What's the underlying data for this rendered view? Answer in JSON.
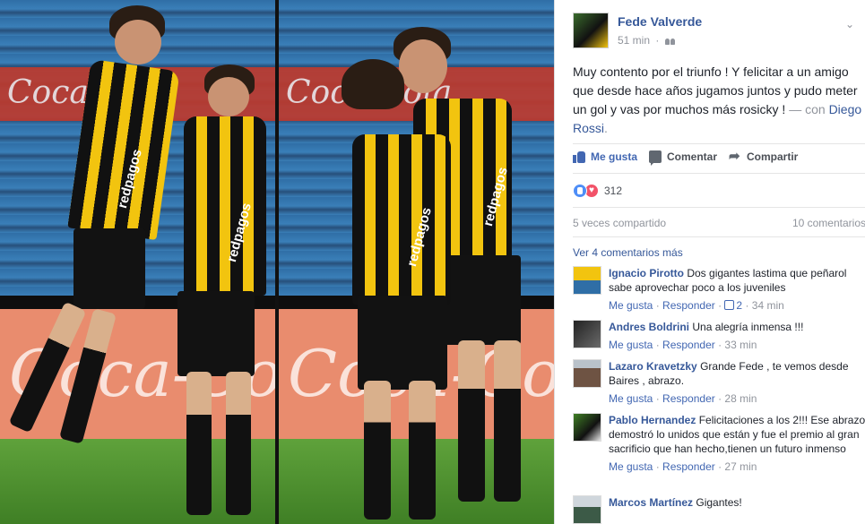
{
  "photo": {
    "ad_text": "Coca-Cola",
    "sponsor": "redpagos"
  },
  "post": {
    "author": "Fede Valverde",
    "time": "51 min",
    "separator": "·",
    "audience_icon": "friends-icon",
    "text_main": "Muy contento por el triunfo ! Y felicitar a un amigo que desde hace años jugamos juntos y pudo meter un gol y vas por muchos más rosicky ! ",
    "with_prefix": "— con ",
    "with_name": "Diego Rossi",
    "with_suffix": "."
  },
  "actions": {
    "like": "Me gusta",
    "comment": "Comentar",
    "share": "Compartir"
  },
  "reactions": {
    "count": "312",
    "types": [
      "like",
      "love"
    ]
  },
  "stats": {
    "shares": "5 veces compartido",
    "comments": "10 comentarios"
  },
  "more_comments": "Ver 4 comentarios más",
  "comments": [
    {
      "name": "Ignacio Pirotto",
      "text": "Dos gigantes lastima que peñarol sabe aprovechar poco a los juveniles",
      "like": "Me gusta",
      "reply": "Responder",
      "likes": "2",
      "time": "34 min"
    },
    {
      "name": "Andres Boldrini",
      "text": "Una alegría inmensa !!!",
      "like": "Me gusta",
      "reply": "Responder",
      "time": "33 min"
    },
    {
      "name": "Lazaro Kravetzky",
      "text": "Grande Fede , te vemos desde Baires , abrazo.",
      "like": "Me gusta",
      "reply": "Responder",
      "time": "28 min"
    },
    {
      "name": "Pablo Hernandez",
      "text": "Felicitaciones a los 2!!! Ese abrazo demostró lo unidos que están y fue el premio al gran sacrificio que han hecho,tienen un futuro inmenso",
      "like": "Me gusta",
      "reply": "Responder",
      "time": "27 min"
    },
    {
      "name": "Marcos Martínez",
      "text": "Gigantes!"
    }
  ],
  "colors": {
    "link": "#365899",
    "accent": "#4267b2",
    "muted": "#90949c"
  }
}
